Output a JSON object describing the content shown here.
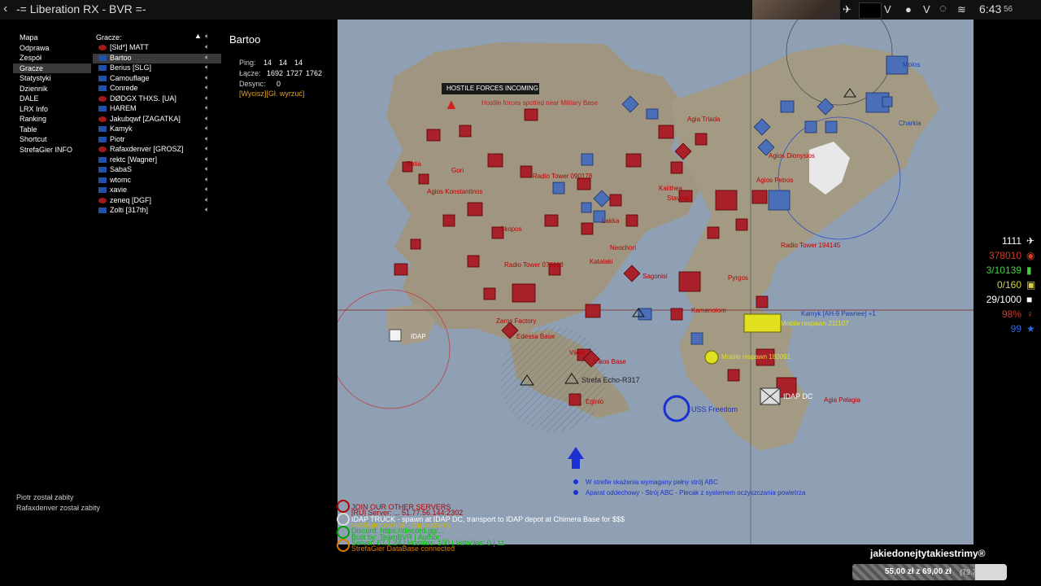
{
  "window": {
    "title": "-= Liberation RX - BVR =-",
    "clock": "6:43",
    "clock_seconds": "56"
  },
  "menu": {
    "items": [
      "Mapa",
      "Odprawa",
      "Zespół",
      "Gracze",
      "Statystyki",
      "Dziennik",
      "DALE",
      "LRX Info",
      "Ranking",
      "Table",
      "Shortcut",
      "StrefaGier INFO"
    ],
    "selected": "Gracze"
  },
  "players": {
    "header": "Gracze:",
    "list": [
      {
        "name": "[Sld*] MATT",
        "flag": "red"
      },
      {
        "name": "Bartoo",
        "flag": "blue",
        "selected": true
      },
      {
        "name": "Berius [SLG]",
        "flag": "blue"
      },
      {
        "name": "Camouflage",
        "flag": "blue"
      },
      {
        "name": "Conrede",
        "flag": "blue"
      },
      {
        "name": "DØDGX THXS. [UA]",
        "flag": "red"
      },
      {
        "name": "HAREM",
        "flag": "blue"
      },
      {
        "name": "Jakubqwf [ZAGATKA]",
        "flag": "red"
      },
      {
        "name": "Kamyk",
        "flag": "blue"
      },
      {
        "name": "Piotr",
        "flag": "blue"
      },
      {
        "name": "Rafaxdenver [GROSZ]",
        "flag": "red"
      },
      {
        "name": "rektc [Wagner]",
        "flag": "blue"
      },
      {
        "name": "SabaS",
        "flag": "blue"
      },
      {
        "name": "wtomc",
        "flag": "blue"
      },
      {
        "name": "xavie",
        "flag": "blue"
      },
      {
        "name": "zeneq [DGF]",
        "flag": "red"
      },
      {
        "name": "Zolti [317th]",
        "flag": "blue"
      }
    ]
  },
  "detail": {
    "name": "Bartoo",
    "ping_label": "Ping:",
    "ping": [
      "14",
      "14",
      "14"
    ],
    "link_label": "Łącze:",
    "link": [
      "1692",
      "1727",
      "1762"
    ],
    "desync_label": "Desync:",
    "desync": "0",
    "actions": "[Wycisz][Gł. wyrzuć]"
  },
  "alert": {
    "title": "HOSTILE FORCES INCOMING",
    "text": "Hostile forces spotted near Military Base"
  },
  "stats": [
    {
      "value": "1111",
      "color": "#ffffff",
      "icon": "aircraft-icon"
    },
    {
      "value": "378010",
      "color": "#d33a2a",
      "icon": "ammo-icon"
    },
    {
      "value": "3/10139",
      "color": "#44d044",
      "icon": "fuel-icon"
    },
    {
      "value": "0/160",
      "color": "#d8d040",
      "icon": "intel-icon"
    },
    {
      "value": "29/1000",
      "color": "#ffffff",
      "icon": "units-icon"
    },
    {
      "value": "98%",
      "color": "#d33a2a",
      "icon": "civrep-icon"
    },
    {
      "value": "99",
      "color": "#2a6ae0",
      "icon": "star-icon"
    }
  ],
  "kills": [
    "Piotr został zabity",
    "Rafaxdenver został zabity"
  ],
  "map_labels": {
    "idap": "IDAP",
    "idap_dc": "IDAP DC",
    "uss": "USS Freedom",
    "strefa": "Strefa Echo-R317",
    "kamyk": "Kamyk [AH-9 Pawnee] +1",
    "respawn1": "Mobile respawn 211107",
    "respawn2": "Mobile respawn 180091",
    "abc1": "W strefie skażenia wymagany pełny strój ABC",
    "abc2": "Aparat oddechowy - Strój ABC - Plecak z systemem oczyszczania powietrza",
    "towns": [
      "Agios Konstantinos",
      "Radio Tower 090178",
      "Radio Tower 076113",
      "Radio Tower 194145",
      "Vikos",
      "Vikos Base",
      "Stavros",
      "Kalithea",
      "Sagonisi",
      "Pyrgos",
      "Agia Pelagia",
      "Fotia",
      "Agia Triada",
      "Molos",
      "Edessa Base",
      "Eginio",
      "Neochori",
      "Gori",
      "Kamenolom",
      "Zaros Factory",
      "Lakka",
      "Katalaki",
      "Agios Petros",
      "Agios Dionysios",
      "Skopos",
      "Charkia"
    ]
  },
  "chat": [
    {
      "text": "JOIN OUR OTHER SERVERS",
      "color": "#b00000"
    },
    {
      "text": "[RU] Server: ... 51.77.56.144:2302",
      "color": "#b00000"
    },
    {
      "text": "IDAP TRUCK - spawn at IDAP DC, transport to IDAP depot at Chimera Base for $$$",
      "color": "#ffffff"
    },
    {
      "text": "strefagier.com.pl - zapraszamy",
      "color": "#c8b800"
    },
    {
      "text": "Discord: https://discord.gg/...",
      "color": "#00c000"
    },
    {
      "text": "Built by: TeamBVR | Author: ...",
      "color": "#00c000"
    },
    {
      "text": "Server: 67.1.24 | Hostiles: 100 | Vehicles: 0 | 11",
      "color": "#00c000"
    },
    {
      "text": "StrefaGier DataBase connected",
      "color": "#e07a00"
    }
  ],
  "streamer": "jakiedonejtytakiestrimy®",
  "donation": {
    "text": "55,00 zł z 69,00 zł",
    "percent_label": "(79.71%)",
    "fraction": 0.7971
  }
}
